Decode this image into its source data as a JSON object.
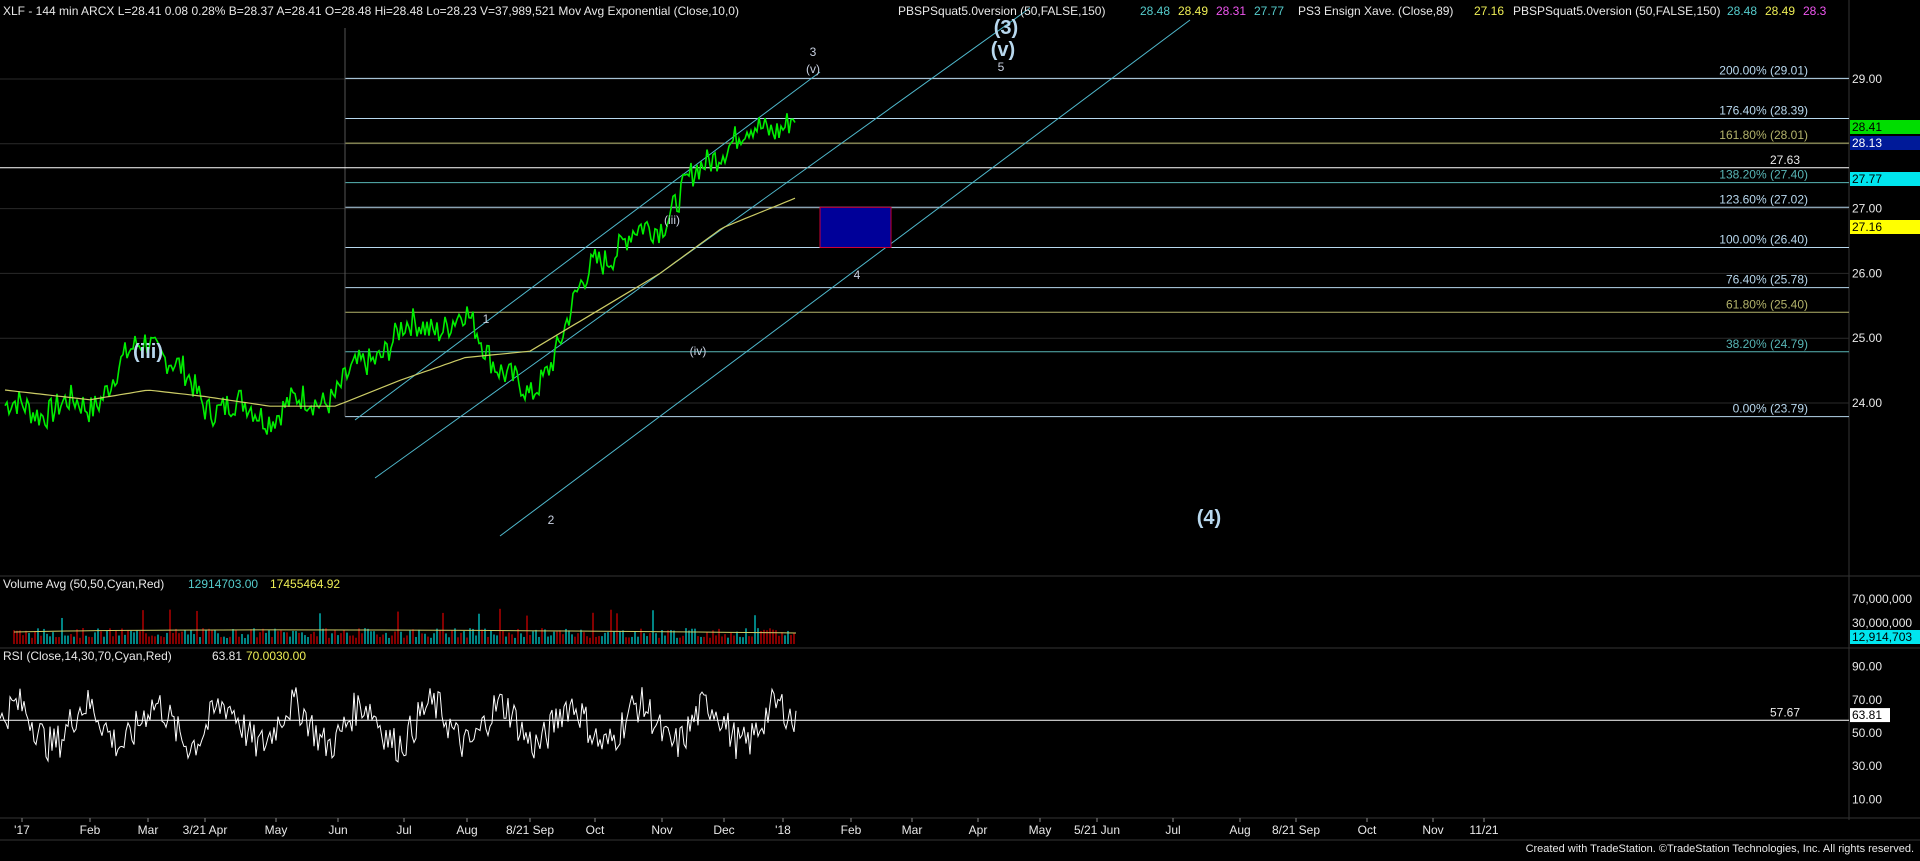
{
  "header": {
    "symbol_line": "XLF - 144 min  ARCX  L=28.41  0.08  0.28%  B=28.37  A=28.41  O=28.48  Hi=28.48  Lo=28.23  V=37,989,521  Mov Avg Exponential (Close,10,0)",
    "study1": "PBSPSquat5.0version (50,FALSE,150)",
    "study1_vals": [
      "28.48",
      "28.49",
      "28.31",
      "27.77"
    ],
    "study2": "PS3 Ensign Xave. (Close,89)",
    "study2_val": "27.16",
    "study3": "PBSPSquat5.0version (50,FALSE,150)",
    "study3_vals": [
      "28.48",
      "28.49",
      "28.3"
    ]
  },
  "volume_panel": {
    "label": "Volume Avg (50,50,Cyan,Red)",
    "val1": "12914703.00",
    "val2": "17455464.92",
    "axis_ticks": [
      "70,000,000",
      "30,000,000"
    ],
    "last_value": "12,914,703"
  },
  "rsi_panel": {
    "label": "RSI (Close,14,30,70,Cyan,Red)",
    "vals": [
      "63.81",
      "70.00",
      "30.00"
    ],
    "axis_ticks": [
      "90.00",
      "70.00",
      "50.00",
      "30.00",
      "10.00"
    ],
    "hline_label": "57.67",
    "last_value": "63.81"
  },
  "price_axis": {
    "ticks": [
      "29.00",
      "28.00",
      "27.00",
      "26.00",
      "25.00",
      "24.00"
    ],
    "tags": [
      {
        "text": "28.41",
        "color": "#00dd00"
      },
      {
        "text": "28.13",
        "color": "#001a99"
      },
      {
        "text": "27.77",
        "color": "#00e5ee"
      },
      {
        "text": "27.16",
        "color": "#ffff00"
      }
    ]
  },
  "fib_levels": [
    {
      "label": "200.00% (29.01)",
      "value": 29.01,
      "color": "#b8d8ee"
    },
    {
      "label": "176.40% (28.39)",
      "value": 28.39,
      "color": "#b8d8ee"
    },
    {
      "label": "161.80% (28.01)",
      "value": 28.01,
      "color": "#b3b36b"
    },
    {
      "label": "138.20% (27.40)",
      "value": 27.4,
      "color": "#58b6b6"
    },
    {
      "label": "123.60% (27.02)",
      "value": 27.02,
      "color": "#b8d8ee"
    },
    {
      "label": "100.00% (26.40)",
      "value": 26.4,
      "color": "#b8d8ee"
    },
    {
      "label": "76.40% (25.78)",
      "value": 25.78,
      "color": "#b8d8ee"
    },
    {
      "label": "61.80% (25.40)",
      "value": 25.4,
      "color": "#b3b36b"
    },
    {
      "label": "38.20% (24.79)",
      "value": 24.79,
      "color": "#58b6b6"
    },
    {
      "label": "0.00% (23.79)",
      "value": 23.79,
      "color": "#b8d8ee"
    }
  ],
  "hline": {
    "label": "27.63",
    "value": 27.63
  },
  "wave_labels": [
    {
      "text": "(iii)",
      "big": true
    },
    {
      "text": "(iii)",
      "big": false
    },
    {
      "text": "(iv)",
      "big": false
    },
    {
      "text": "1",
      "big": false
    },
    {
      "text": "2",
      "big": false
    },
    {
      "text": "3",
      "big": false
    },
    {
      "text": "(v)",
      "big": false
    },
    {
      "text": "(3)",
      "big": true
    },
    {
      "text": "(v)",
      "big": true
    },
    {
      "text": "5",
      "big": false
    },
    {
      "text": "4",
      "big": false
    },
    {
      "text": "(4)",
      "big": true
    }
  ],
  "x_axis": {
    "ticks": [
      "'17",
      "Feb",
      "Mar",
      "3/21 Apr",
      "May",
      "Jun",
      "Jul",
      "Aug",
      "8/21 Sep",
      "Oct",
      "Nov",
      "Dec",
      "'18",
      "Feb",
      "Mar",
      "Apr",
      "May",
      "5/21 Jun",
      "Jul",
      "Aug",
      "8/21 Sep",
      "Oct",
      "Nov",
      "11/21"
    ]
  },
  "footer": "Created with TradeStation. ©TradeStation Technologies, Inc. All rights reserved.",
  "colors": {
    "price": "#00ee00",
    "avg": "#cccc66",
    "channel": "#4fb8cc",
    "box": "#000099",
    "box_border": "#cc0033",
    "grid": "#2a2a2a",
    "rsi": "#ffffff"
  },
  "chart_data": [
    {
      "type": "line",
      "title": "XLF - 144 min ARCX",
      "x": [
        "'17",
        "Feb",
        "Mar",
        "3/21 Apr",
        "May",
        "Jun",
        "Jul",
        "Aug",
        "8/21 Sep",
        "Oct",
        "Nov",
        "Dec",
        "'18"
      ],
      "series": [
        {
          "name": "XLF",
          "values": [
            23.9,
            23.95,
            25.05,
            24.0,
            23.85,
            24.15,
            25.1,
            25.3,
            24.0,
            26.2,
            26.8,
            28.0,
            28.41
          ]
        },
        {
          "name": "PS3 Ensign Xave. (Close,89)",
          "values": [
            24.2,
            24.05,
            24.2,
            24.1,
            23.95,
            23.95,
            24.35,
            24.7,
            24.8,
            25.4,
            26.0,
            26.7,
            27.16
          ]
        }
      ],
      "ylim": [
        23.2,
        29.4
      ]
    },
    {
      "type": "bar",
      "title": "Volume Avg (50,50,Cyan,Red)",
      "series": [
        {
          "name": "Volume Avg",
          "values": [
            12914703,
            17455464.92
          ]
        }
      ]
    },
    {
      "type": "line",
      "title": "RSI (Close,14,30,70,Cyan,Red)",
      "series": [
        {
          "name": "RSI",
          "values": [
            63.81
          ]
        }
      ],
      "ylim": [
        0,
        100
      ]
    }
  ]
}
